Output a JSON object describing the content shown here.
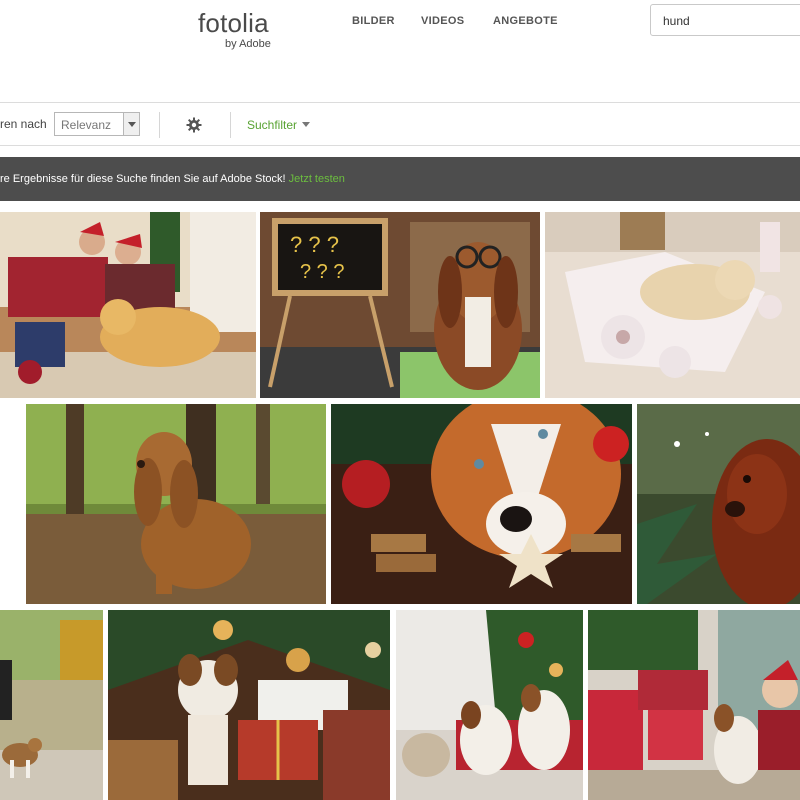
{
  "header": {
    "logo_main": "fotolia",
    "logo_sub": "by Adobe",
    "nav": [
      "BILDER",
      "VIDEOS",
      "ANGEBOTE"
    ]
  },
  "search": {
    "value": "hund"
  },
  "toolbar": {
    "sort_label": "ren nach",
    "sort_value": "Relevanz",
    "filter_label": "Suchfilter"
  },
  "banner": {
    "text": "re Ergebnisse für diese Suche finden Sie auf Adobe Stock!",
    "link": "Jetzt testen"
  },
  "colors": {
    "brand_green": "#58a332",
    "banner_bg": "#4d4d4d",
    "link_green": "#6cbf3f"
  },
  "results": [
    {
      "icon": "christmas-family-with-golden-retriever"
    },
    {
      "icon": "basset-hound-with-glasses-and-chalkboard"
    },
    {
      "icon": "puppy-with-toilet-paper"
    },
    {
      "icon": "cocker-spaniel-in-forest"
    },
    {
      "icon": "dog-with-christmas-cookies"
    },
    {
      "icon": "setter-dog-with-fir-branch"
    },
    {
      "icon": "person-walking-beagle"
    },
    {
      "icon": "jack-russell-with-gifts"
    },
    {
      "icon": "cat-and-two-dogs-at-christmas"
    },
    {
      "icon": "child-with-dog-and-presents"
    }
  ]
}
